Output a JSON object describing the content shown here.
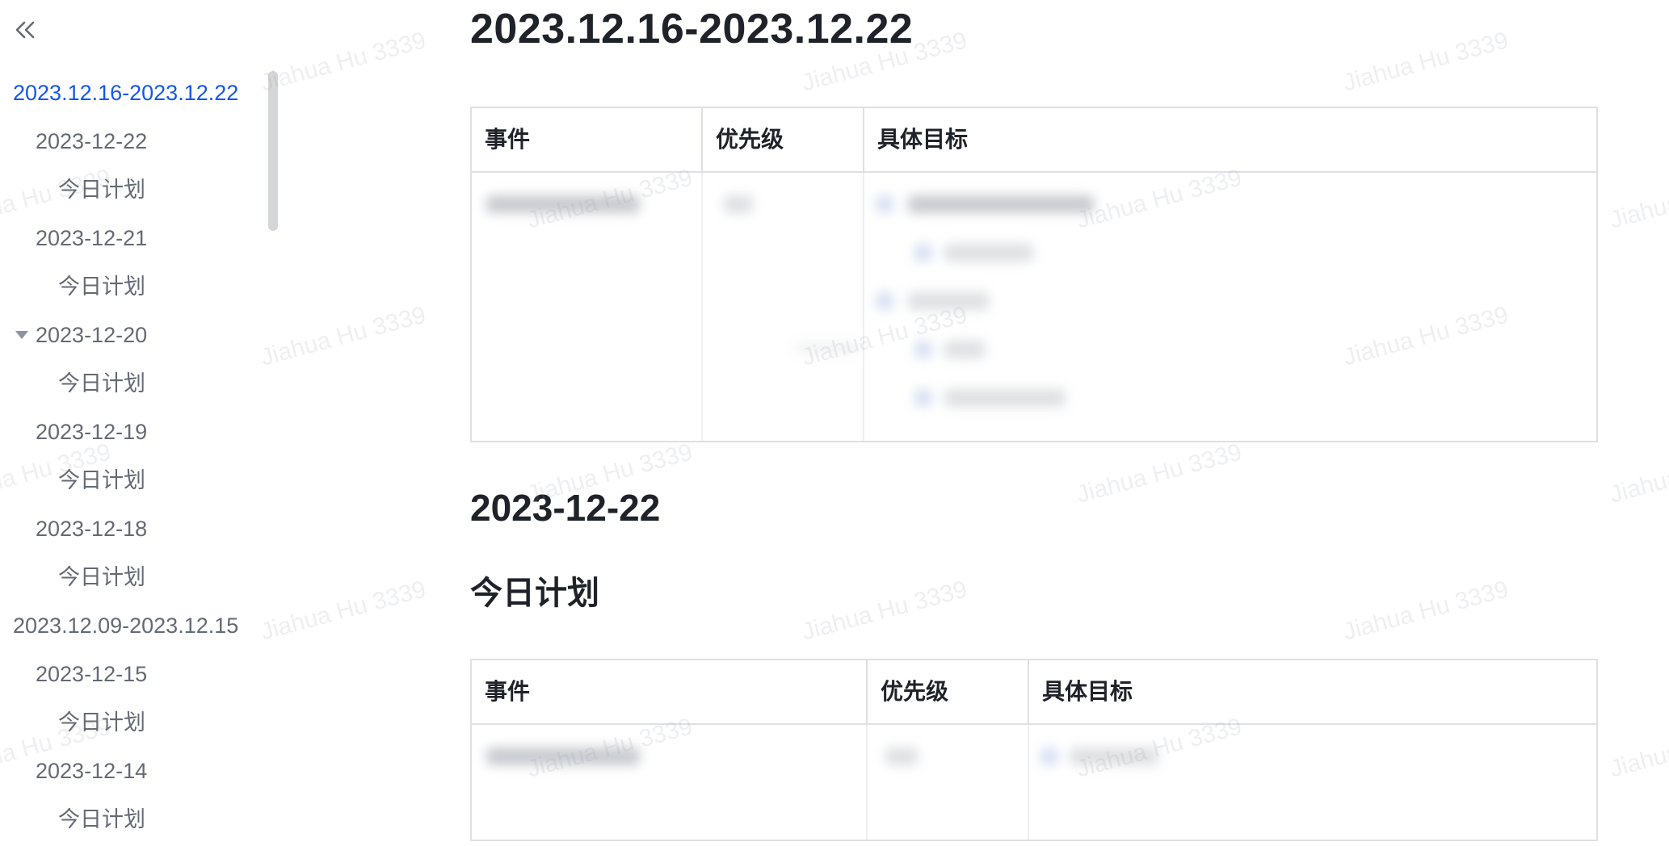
{
  "sidebar": {
    "collapse_icon": "double-chevron-left-icon",
    "items": [
      {
        "label": "2023.12.16-2023.12.22",
        "level": 1,
        "active": true
      },
      {
        "label": "2023-12-22",
        "level": 2
      },
      {
        "label": "今日计划",
        "level": 3
      },
      {
        "label": "2023-12-21",
        "level": 2
      },
      {
        "label": "今日计划",
        "level": 3
      },
      {
        "label": "2023-12-20",
        "level": 2,
        "expanded": true
      },
      {
        "label": "今日计划",
        "level": 3
      },
      {
        "label": "2023-12-19",
        "level": 2
      },
      {
        "label": "今日计划",
        "level": 3
      },
      {
        "label": "2023-12-18",
        "level": 2
      },
      {
        "label": "今日计划",
        "level": 3
      },
      {
        "label": "2023.12.09-2023.12.15",
        "level": 1
      },
      {
        "label": "2023-12-15",
        "level": 2
      },
      {
        "label": "今日计划",
        "level": 3
      },
      {
        "label": "2023-12-14",
        "level": 2
      },
      {
        "label": "今日计划",
        "level": 3
      }
    ]
  },
  "doc": {
    "week_heading": "2023.12.16-2023.12.22",
    "table1": {
      "headers": [
        "事件",
        "优先级",
        "具体目标"
      ]
    },
    "day_heading": "2023-12-22",
    "plan_heading": "今日计划",
    "table2": {
      "headers": [
        "事件",
        "优先级",
        "具体目标"
      ]
    }
  },
  "watermark": "Jiahua Hu 3339",
  "colors": {
    "active_link": "#1456f0",
    "outline_text": "#646a73",
    "heading_text": "#1f2329",
    "table_border": "#dee0e3"
  }
}
